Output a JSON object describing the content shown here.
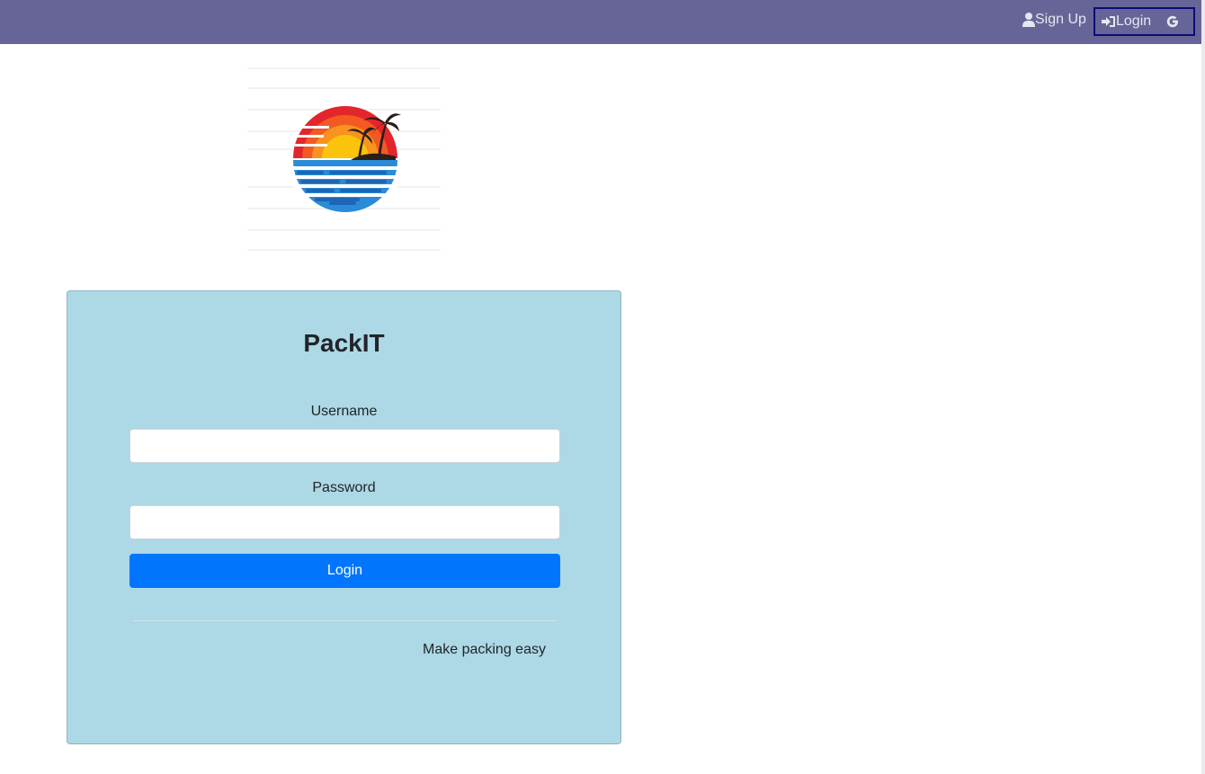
{
  "navbar": {
    "signup_label": "Sign Up",
    "login_label": "Login",
    "signup_icon": "user-icon",
    "login_icon": "sign-in-icon",
    "google_icon": "google-icon",
    "background_color": "#676598"
  },
  "logo": {
    "alt": "sunset-palm-tree-logo"
  },
  "login_card": {
    "title": "PackIT",
    "username_label": "Username",
    "username_value": "",
    "password_label": "Password",
    "password_value": "",
    "login_button": "Login",
    "tagline": "Make packing easy",
    "background_color": "#add8e6",
    "button_color": "#0275fd"
  }
}
